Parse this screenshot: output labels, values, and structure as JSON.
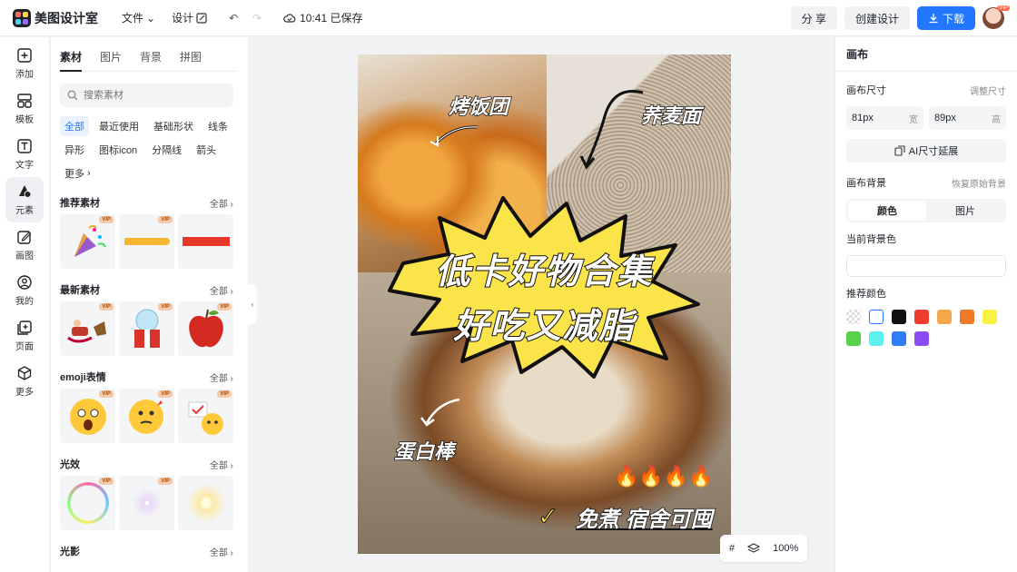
{
  "app": {
    "name": "美图设计室",
    "save_time": "10:41 已保存"
  },
  "top_menu": {
    "file": "文件",
    "design": "设计"
  },
  "top_actions": {
    "share": "分 享",
    "create": "创建设计",
    "download": "下载",
    "avatar_badge": "VIP"
  },
  "left_nav": [
    {
      "label": "添加",
      "icon": "plus-square-icon"
    },
    {
      "label": "模板",
      "icon": "template-icon"
    },
    {
      "label": "文字",
      "icon": "text-icon"
    },
    {
      "label": "元素",
      "icon": "element-icon"
    },
    {
      "label": "画图",
      "icon": "draw-icon"
    },
    {
      "label": "我的",
      "icon": "user-icon"
    },
    {
      "label": "页面",
      "icon": "page-icon"
    },
    {
      "label": "更多",
      "icon": "cube-icon"
    }
  ],
  "panel": {
    "tabs": [
      "素材",
      "图片",
      "背景",
      "拼图"
    ],
    "search_placeholder": "搜索素材",
    "chips": [
      "全部",
      "最近使用",
      "基础形状",
      "线条",
      "异形",
      "图标icon",
      "分隔线",
      "箭头",
      "更多"
    ],
    "sections": [
      {
        "title": "推荐素材",
        "all": "全部"
      },
      {
        "title": "最新素材",
        "all": "全部"
      },
      {
        "title": "emoji表情",
        "all": "全部"
      },
      {
        "title": "光效",
        "all": "全部"
      },
      {
        "title": "光影",
        "all": "全部"
      }
    ],
    "vip_badge": "VIP"
  },
  "poster": {
    "title_line1": "低卡好物合集",
    "title_line2": "好吃又减脂",
    "label_rice": "烤饭团",
    "label_noodle": "荞麦面",
    "label_bread": "蛋白棒",
    "label_bottom": "免煮 宿舍可囤",
    "fires": "🔥🔥🔥🔥"
  },
  "zoom": {
    "level": "100%"
  },
  "right_panel": {
    "title": "画布",
    "size_label": "画布尺寸",
    "size_link": "调整尺寸",
    "width_value": "81px",
    "width_unit": "宽",
    "height_value": "89px",
    "height_unit": "高",
    "ai_extend": "AI尺寸延展",
    "bg_label": "画布背景",
    "bg_restore": "恢复原始背景",
    "seg_color": "颜色",
    "seg_image": "图片",
    "current_bg_label": "当前背景色",
    "recommend_label": "推荐颜色",
    "swatches": [
      "transparent",
      "#ffffff",
      "#111111",
      "#f03c2e",
      "#f5a54a",
      "#f07a2c",
      "#f8f245",
      "#5ad14a",
      "#5ef0ef",
      "#2e7cf6",
      "#8a4cf0"
    ]
  }
}
